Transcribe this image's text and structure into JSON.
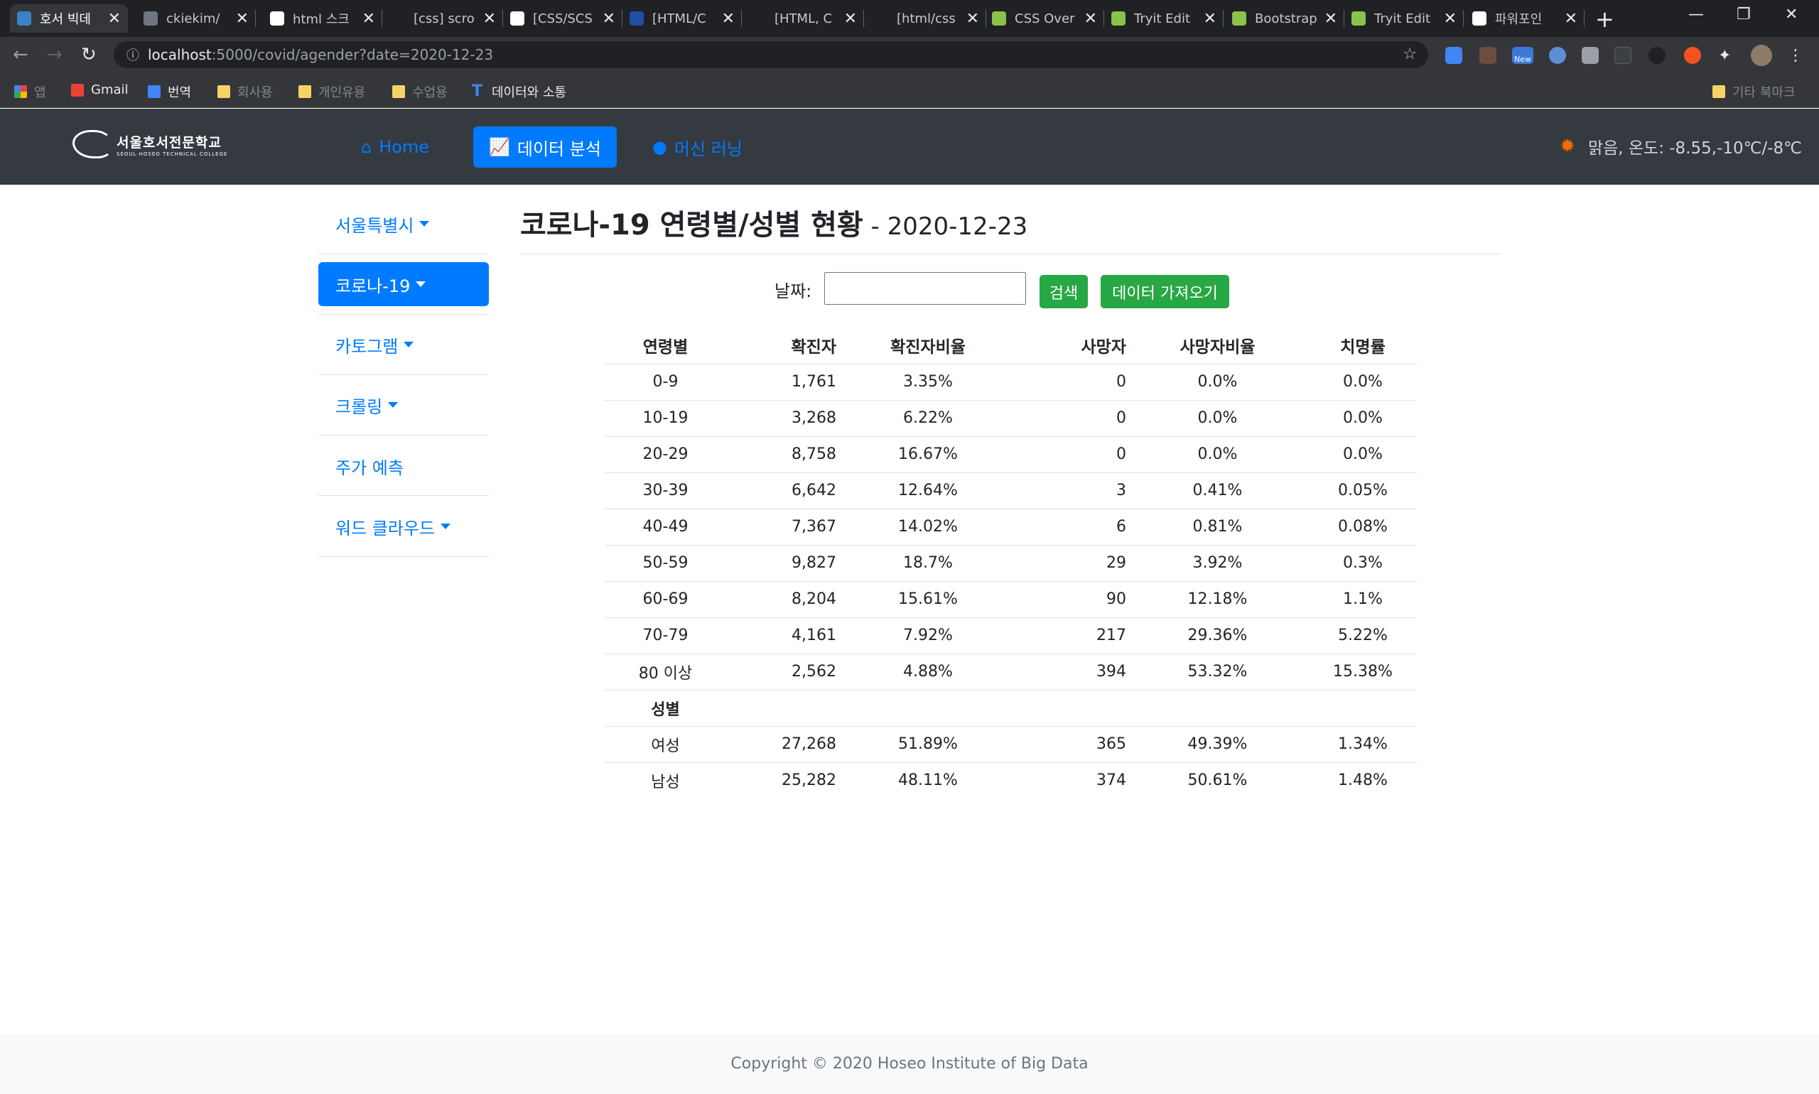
{
  "browser": {
    "tabs": [
      {
        "title": "호서 빅데",
        "active": true
      },
      {
        "title": "ckiekim/"
      },
      {
        "title": "html 스크"
      },
      {
        "title": "[css] scro"
      },
      {
        "title": "[CSS/SCS"
      },
      {
        "title": "[HTML/C"
      },
      {
        "title": "[HTML, C"
      },
      {
        "title": "[html/css"
      },
      {
        "title": "CSS Over"
      },
      {
        "title": "Tryit Edit"
      },
      {
        "title": "Bootstrap"
      },
      {
        "title": "Tryit Edit"
      },
      {
        "title": "파워포인"
      }
    ],
    "close_glyph": "✕",
    "new_tab_glyph": "+",
    "url_host": "localhost",
    "url_path": ":5000/covid/agender?date=2020-12-23",
    "new_badge": "New",
    "bookmarks": [
      {
        "label": "앱"
      },
      {
        "label": "Gmail"
      },
      {
        "label": "번역"
      },
      {
        "label": "회사용"
      },
      {
        "label": "개인유용"
      },
      {
        "label": "수업용"
      },
      {
        "label": "데이터와 소통"
      }
    ],
    "other_bookmarks": "기타 북마크"
  },
  "site": {
    "logo_ko": "서울호서전문학교",
    "logo_en": "SEOUL HOSEO TECHNICAL COLLEGE",
    "nav": [
      {
        "label": "Home",
        "icon": "home-icon"
      },
      {
        "label": "데이터 분석",
        "icon": "chart-line-icon",
        "active": true
      },
      {
        "label": "머신 러닝",
        "icon": "brain-icon"
      }
    ],
    "weather": "맑음, 온도: -8.55,-10℃/-8℃"
  },
  "sidebar": {
    "items": [
      {
        "label": "서울특별시",
        "dropdown": true
      },
      {
        "label": "코로나-19",
        "dropdown": true,
        "active": true
      },
      {
        "label": "카토그램",
        "dropdown": true
      },
      {
        "label": "크롤링",
        "dropdown": true
      },
      {
        "label": "주가 예측",
        "dropdown": false
      },
      {
        "label": "워드 클라우드",
        "dropdown": true
      }
    ]
  },
  "main": {
    "title": "코로나-19 연령별/성별 현황",
    "subtitle": " - 2020-12-23",
    "date_label": "날짜:",
    "date_value": "",
    "search_button": "검색",
    "fetch_button": "데이터 가져오기",
    "table": {
      "headers": [
        "연령별",
        "확진자",
        "확진자비율",
        "사망자",
        "사망자비율",
        "치명률"
      ],
      "age_rows": [
        [
          "0-9",
          "1,761",
          "3.35%",
          "0",
          "0.0%",
          "0.0%"
        ],
        [
          "10-19",
          "3,268",
          "6.22%",
          "0",
          "0.0%",
          "0.0%"
        ],
        [
          "20-29",
          "8,758",
          "16.67%",
          "0",
          "0.0%",
          "0.0%"
        ],
        [
          "30-39",
          "6,642",
          "12.64%",
          "3",
          "0.41%",
          "0.05%"
        ],
        [
          "40-49",
          "7,367",
          "14.02%",
          "6",
          "0.81%",
          "0.08%"
        ],
        [
          "50-59",
          "9,827",
          "18.7%",
          "29",
          "3.92%",
          "0.3%"
        ],
        [
          "60-69",
          "8,204",
          "15.61%",
          "90",
          "12.18%",
          "1.1%"
        ],
        [
          "70-79",
          "4,161",
          "7.92%",
          "217",
          "29.36%",
          "5.22%"
        ],
        [
          "80 이상",
          "2,562",
          "4.88%",
          "394",
          "53.32%",
          "15.38%"
        ]
      ],
      "gender_label": "성별",
      "gender_rows": [
        [
          "여성",
          "27,268",
          "51.89%",
          "365",
          "49.39%",
          "1.34%"
        ],
        [
          "남성",
          "25,282",
          "48.11%",
          "374",
          "50.61%",
          "1.48%"
        ]
      ]
    }
  },
  "footer": {
    "text": "Copyright © 2020 Hoseo Institute of Big Data"
  },
  "colors": {
    "primary": "#007bff",
    "success": "#28a745",
    "navbar": "#343a40"
  }
}
